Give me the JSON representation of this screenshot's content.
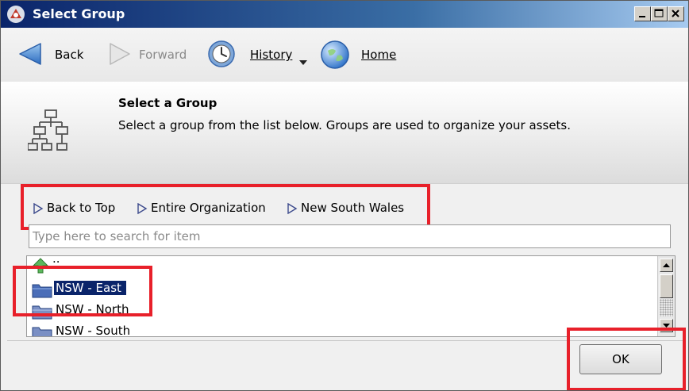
{
  "window": {
    "title": "Select Group",
    "controls": [
      "minimize",
      "maximize",
      "close"
    ]
  },
  "toolbar": {
    "back_label": "Back",
    "forward_label": "Forward",
    "history_label": "History",
    "home_label": "Home"
  },
  "header": {
    "title": "Select a Group",
    "description": "Select a group from the list below. Groups are used to organize your assets.",
    "icon": "hierarchy-icon"
  },
  "breadcrumb": {
    "items": [
      {
        "label": "Back to Top"
      },
      {
        "label": "Entire Organization"
      },
      {
        "label": "New South Wales"
      }
    ]
  },
  "search": {
    "placeholder": "Type here to search for item",
    "value": ""
  },
  "list": {
    "items": [
      {
        "label": "..",
        "icon": "up-arrow-icon",
        "selected": false
      },
      {
        "label": "NSW - East",
        "icon": "folder-icon",
        "selected": true
      },
      {
        "label": "NSW - North",
        "icon": "folder-icon",
        "selected": false
      },
      {
        "label": "NSW - South",
        "icon": "folder-icon",
        "selected": false
      }
    ]
  },
  "footer": {
    "ok_label": "OK"
  },
  "colors": {
    "highlight": "#e8202a",
    "selection": "#0a246a",
    "title_bar": "#0a246a"
  }
}
